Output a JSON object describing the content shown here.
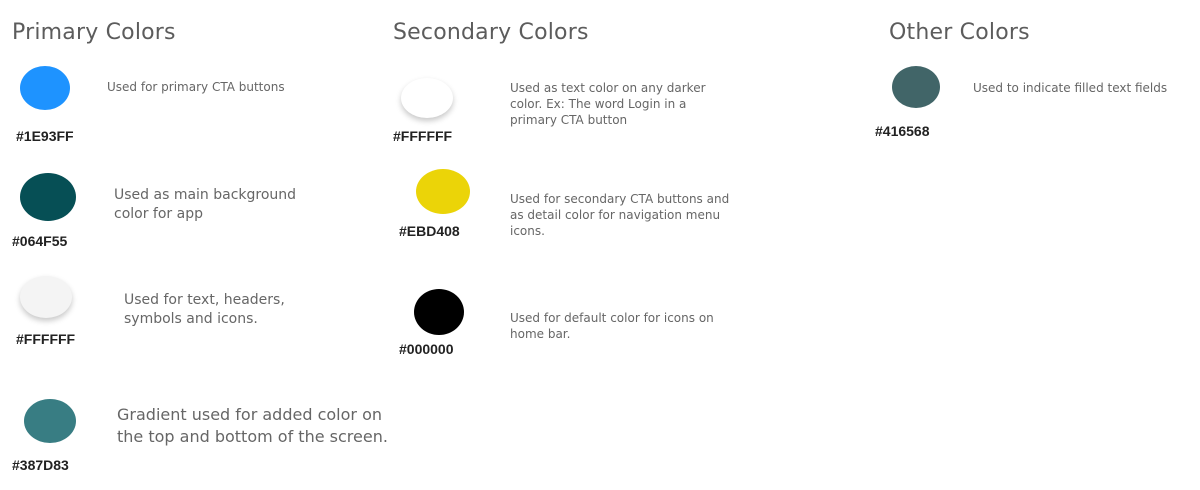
{
  "primary": {
    "title": "Primary Colors",
    "items": [
      {
        "hex": "#1E93FF",
        "color": "#1E93FF",
        "description": "Used for primary CTA buttons"
      },
      {
        "hex": "#064F55",
        "color": "#064F55",
        "description": "Used as main background color for app"
      },
      {
        "hex": "#FFFFFF",
        "color": "#F4F4F4",
        "description": "Used for text, headers, symbols and icons."
      },
      {
        "hex": "#387D83",
        "color": "#387D83",
        "description": "Gradient used for added color on the top and bottom of the screen."
      }
    ]
  },
  "secondary": {
    "title": "Secondary Colors",
    "items": [
      {
        "hex": "#FFFFFF",
        "color": "#FFFFFF",
        "description": "Used as text color on any darker color. Ex: The word Login in a primary CTA button"
      },
      {
        "hex": "#EBD408",
        "color": "#EBD408",
        "description": "Used for secondary CTA buttons and as detail color for navigation menu icons."
      },
      {
        "hex": "#000000",
        "color": "#000000",
        "description": "Used for default color for icons on home bar."
      }
    ]
  },
  "other": {
    "title": "Other Colors",
    "items": [
      {
        "hex": "#416568",
        "color": "#416568",
        "description": "Used to indicate filled text fields"
      }
    ]
  }
}
